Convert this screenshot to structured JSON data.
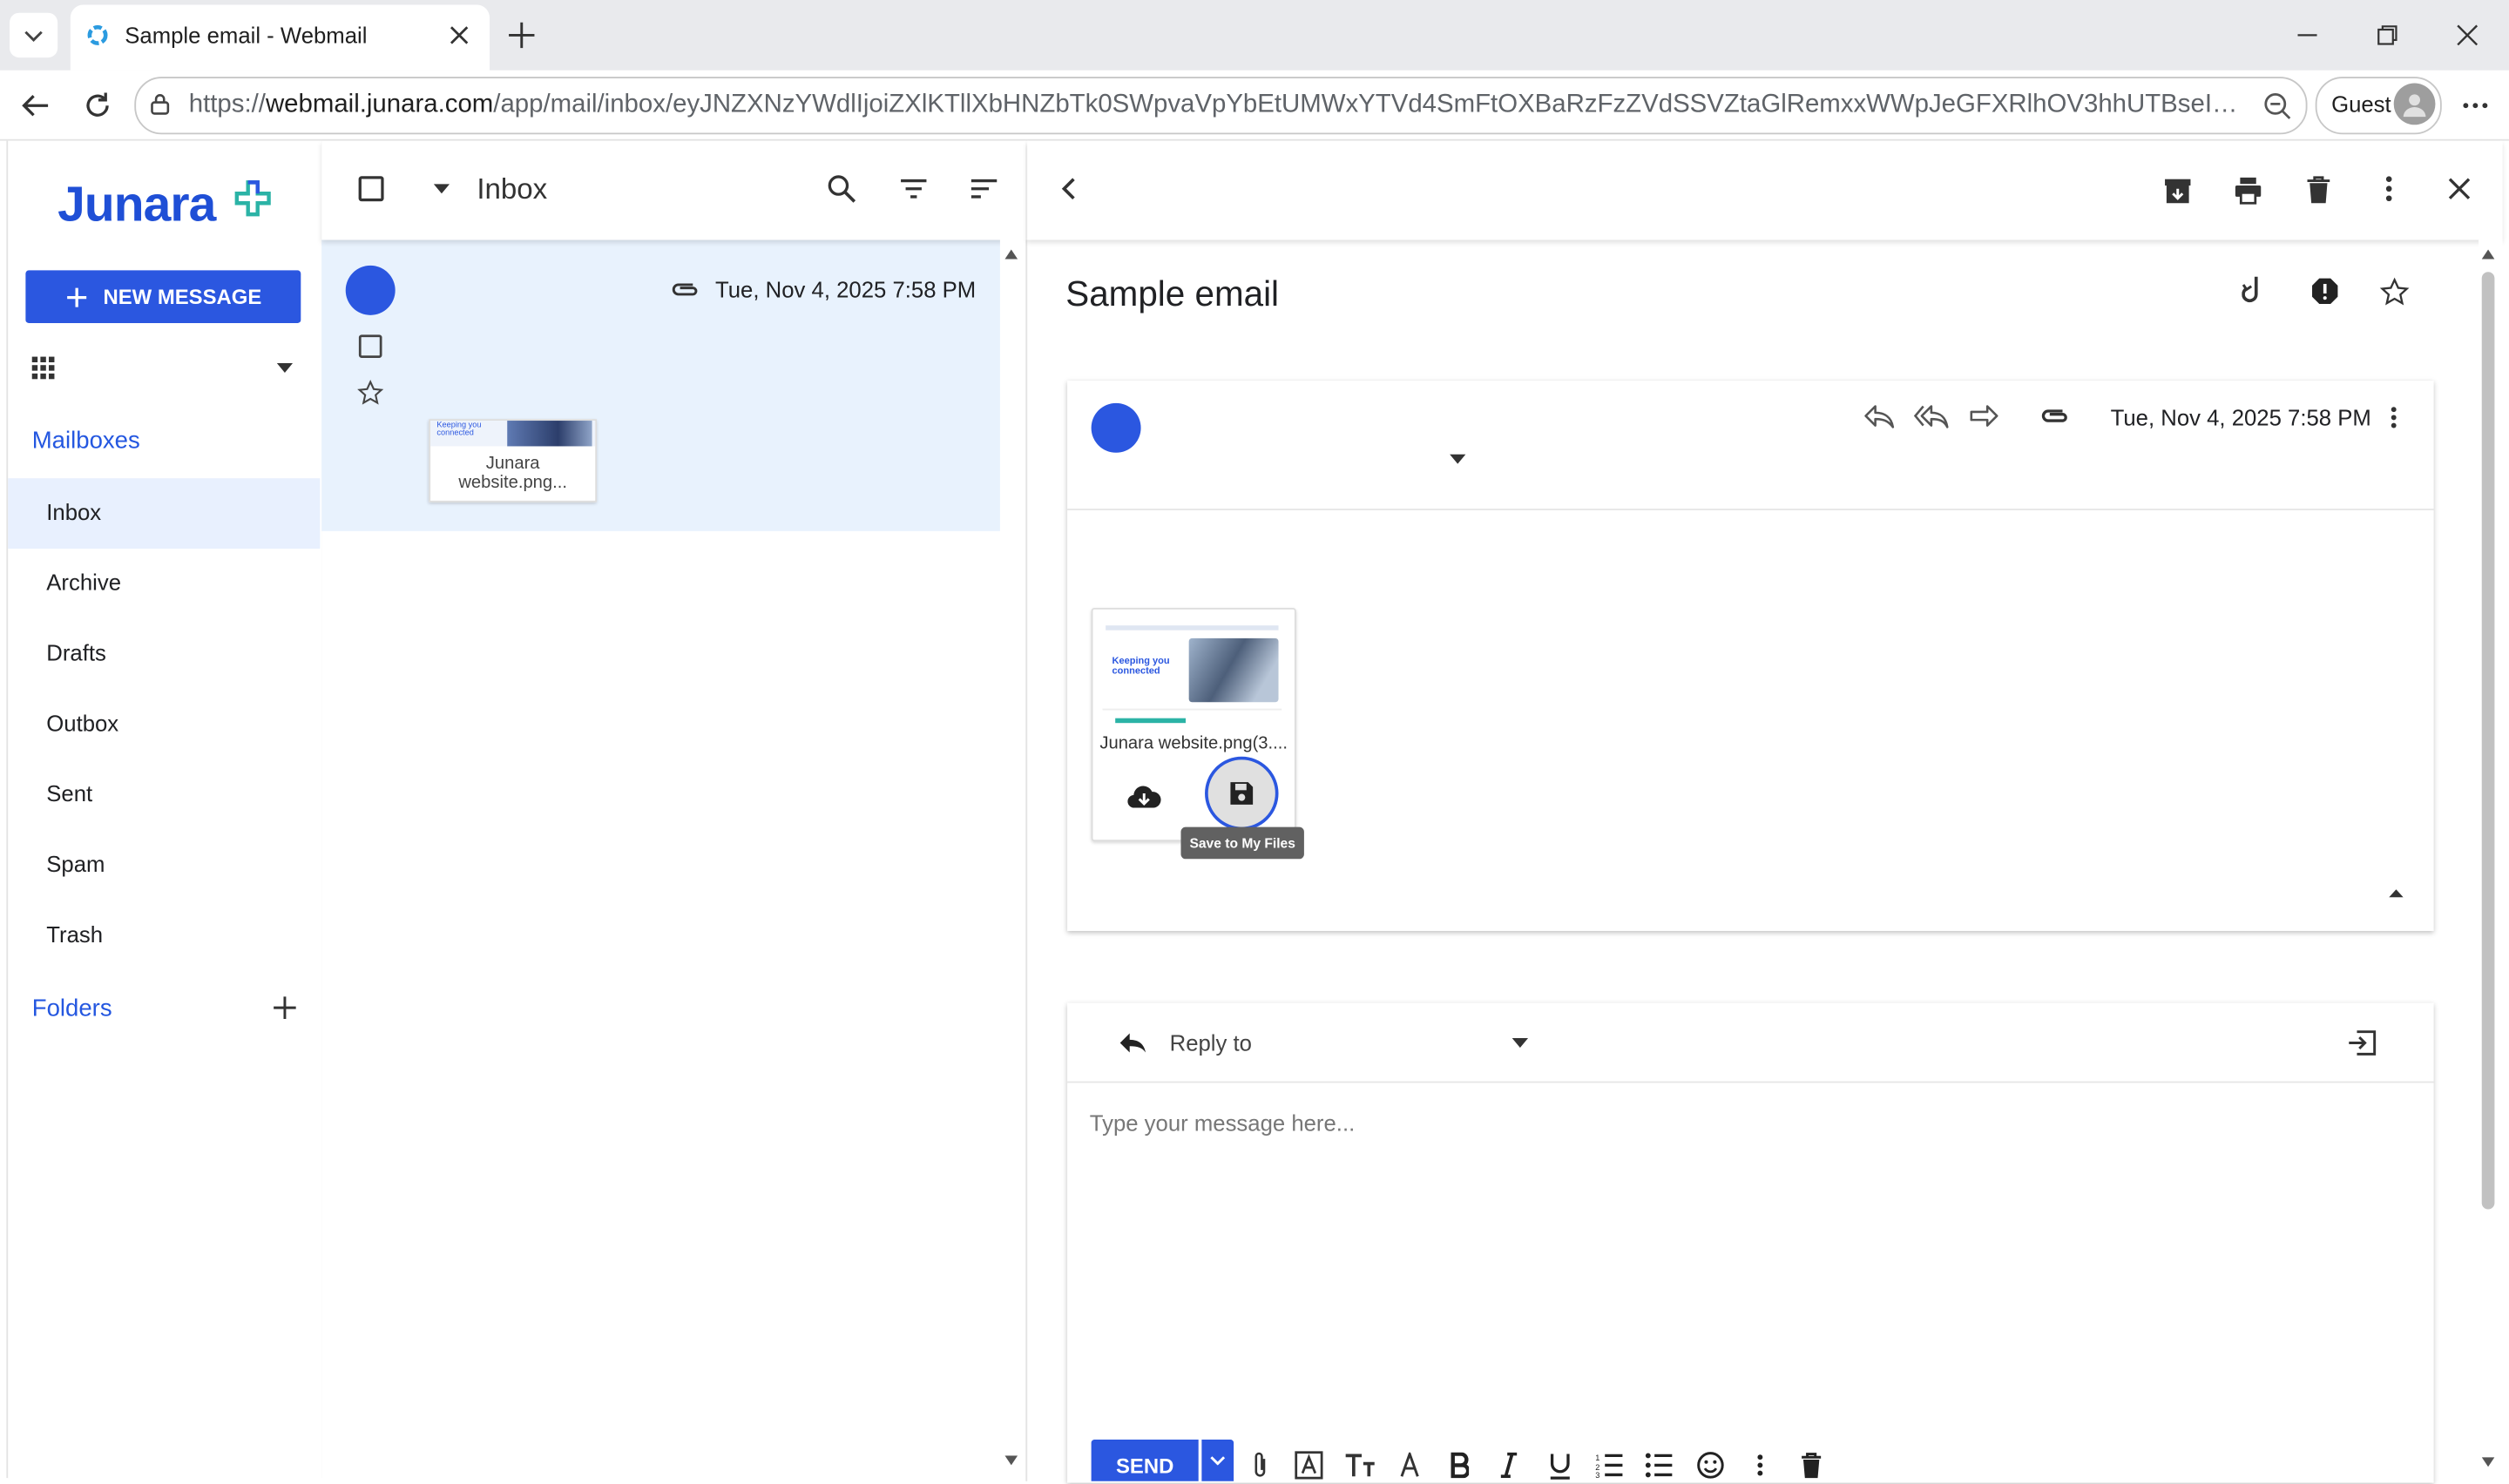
{
  "browser": {
    "tab_title": "Sample email - Webmail",
    "url_prefix": "https://",
    "url_host": "webmail.junara.com",
    "url_path": "/app/mail/inbox/eyJNZXNzYWdlIjoiZXlKTllXbHNZbTk0SWpvaVpYbEtUMWxYTVd4SmFtOXBaRzFzZVdSSVZtaGlRemxxWWpJeGFXRlhOV3hhUTBseINXdFNiR0pIYkhS...",
    "profile_label": "Guest"
  },
  "app": {
    "logo_text": "Junara",
    "brand_color": "#2b57e0",
    "new_message_label": "NEW MESSAGE",
    "mailboxes_heading": "Mailboxes",
    "folders_heading": "Folders",
    "mailboxes": [
      {
        "label": "Inbox",
        "active": true
      },
      {
        "label": "Archive"
      },
      {
        "label": "Drafts"
      },
      {
        "label": "Outbox"
      },
      {
        "label": "Sent"
      },
      {
        "label": "Spam"
      },
      {
        "label": "Trash"
      }
    ]
  },
  "list": {
    "folder_title": "Inbox",
    "messages": [
      {
        "date": "Tue, Nov 4, 2025 7:58 PM",
        "attachment_name": "Junara website.png...",
        "thumbnail_text": "Keeping you connected"
      }
    ]
  },
  "reader": {
    "subject": "Sample email",
    "date": "Tue, Nov 4, 2025 7:58 PM",
    "attachment": {
      "name": "Junara website.png(3....",
      "thumbnail_text": "Keeping you connected",
      "tooltip": "Save to My Files"
    },
    "reply": {
      "label": "Reply to",
      "placeholder": "Type your message here...",
      "send_label": "SEND"
    }
  }
}
